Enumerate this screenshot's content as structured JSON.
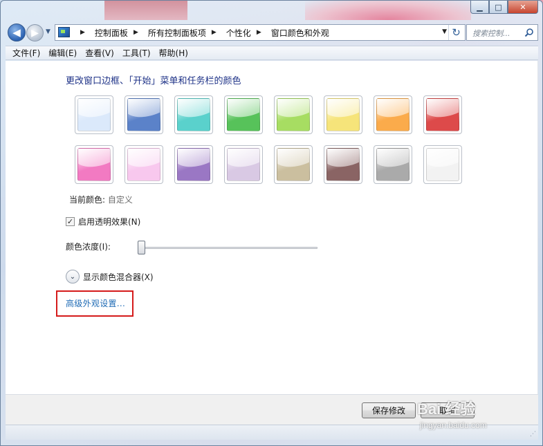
{
  "window": {
    "caption_buttons": {
      "minimize": "▁",
      "maximize": "□",
      "close": "✕"
    }
  },
  "nav": {
    "back_glyph": "◀",
    "forward_glyph": "▶",
    "history_glyph": "▼",
    "breadcrumbs": [
      "控制面板",
      "所有控制面板项",
      "个性化",
      "窗口颜色和外观"
    ],
    "breadcrumb_sep": "▶",
    "dropdown_glyph": "▼",
    "refresh_glyph": "↻",
    "search_placeholder": "搜索控制..."
  },
  "menu": {
    "items": [
      "文件(F)",
      "编辑(E)",
      "查看(V)",
      "工具(T)",
      "帮助(H)"
    ]
  },
  "main": {
    "heading": "更改窗口边框、「开始」菜单和任务栏的颜色",
    "swatch_colors": [
      [
        "#dbe9fb",
        "#5b82c9",
        "#5ad1cc",
        "#57c25a",
        "#a7dd62",
        "#f6e47a",
        "#fbab4b",
        "#dd4a4a"
      ],
      [
        "#f27ac2",
        "#f8c8ee",
        "#9a77c4",
        "#d9c9e4",
        "#cbbf9f",
        "#8a6464",
        "#aaaaaa",
        "#f2f2f2"
      ]
    ],
    "current_color_label": "当前颜色:",
    "current_color_value": "自定义",
    "transparency_checked": true,
    "transparency_check_glyph": "✓",
    "transparency_label": "启用透明效果(N)",
    "intensity_label": "颜色浓度(I):",
    "intensity_level": 0.0,
    "mixer_expand_glyph": "⌄",
    "mixer_label": "显示颜色混合器(X)",
    "advanced_link": "高级外观设置..."
  },
  "footer": {
    "save_label": "保存修改",
    "cancel_label": "取消",
    "resize_grip": "⋰"
  },
  "watermark": {
    "text": "Bai 经验",
    "sub": "jingyan.baidu.com"
  },
  "colors": {
    "heading": "#1e3287",
    "link": "#1f6bb5",
    "highlight": "#d51a1a"
  }
}
